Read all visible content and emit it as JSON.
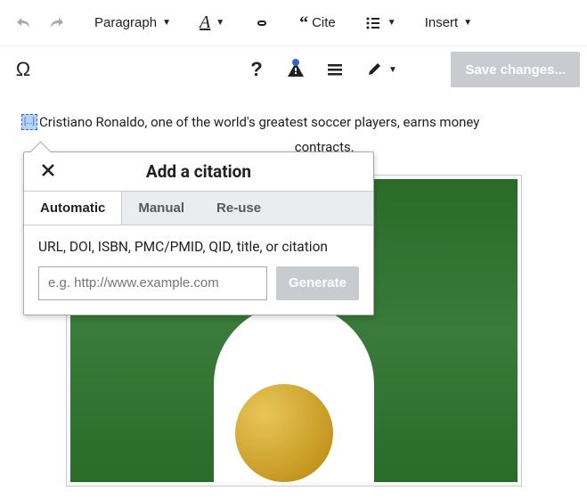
{
  "toolbar": {
    "paragraph_label": "Paragraph",
    "cite_label": "Cite",
    "insert_label": "Insert",
    "save_label": "Save changes..."
  },
  "article": {
    "ref_marker": "[...]",
    "line1": "Cristiano Ronaldo, one of the world's greatest soccer players, earns money",
    "line2_fragment": "contracts."
  },
  "citation_popup": {
    "title": "Add a citation",
    "tabs": {
      "automatic": "Automatic",
      "manual": "Manual",
      "reuse": "Re-use"
    },
    "field_label": "URL, DOI, ISBN, PMC/PMID, QID, title, or citation",
    "input_value": "",
    "input_placeholder": "e.g. http://www.example.com",
    "generate_label": "Generate"
  }
}
